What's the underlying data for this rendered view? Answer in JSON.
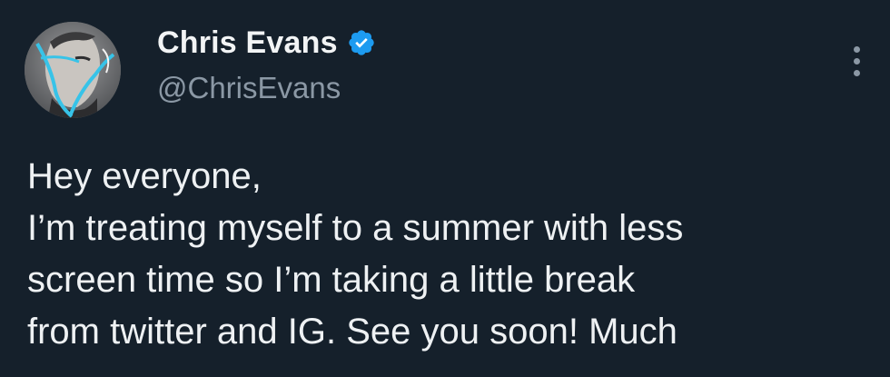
{
  "author": {
    "display_name": "Chris Evans",
    "handle": "@ChrisEvans",
    "verified": true,
    "avatar_icon": "profile-photo",
    "verified_icon": "verified-badge-icon",
    "verified_color": "#1d9bf0"
  },
  "menu": {
    "icon": "more-options-icon"
  },
  "tweet": {
    "lines": [
      "Hey everyone,",
      "I’m treating myself to a summer with less",
      "screen time so I’m taking a little break",
      "from twitter and IG. See you soon! Much"
    ]
  },
  "colors": {
    "background": "#15202b",
    "text": "#e7e9ea",
    "secondary_text": "#8b98a5",
    "accent": "#1d9bf0"
  }
}
